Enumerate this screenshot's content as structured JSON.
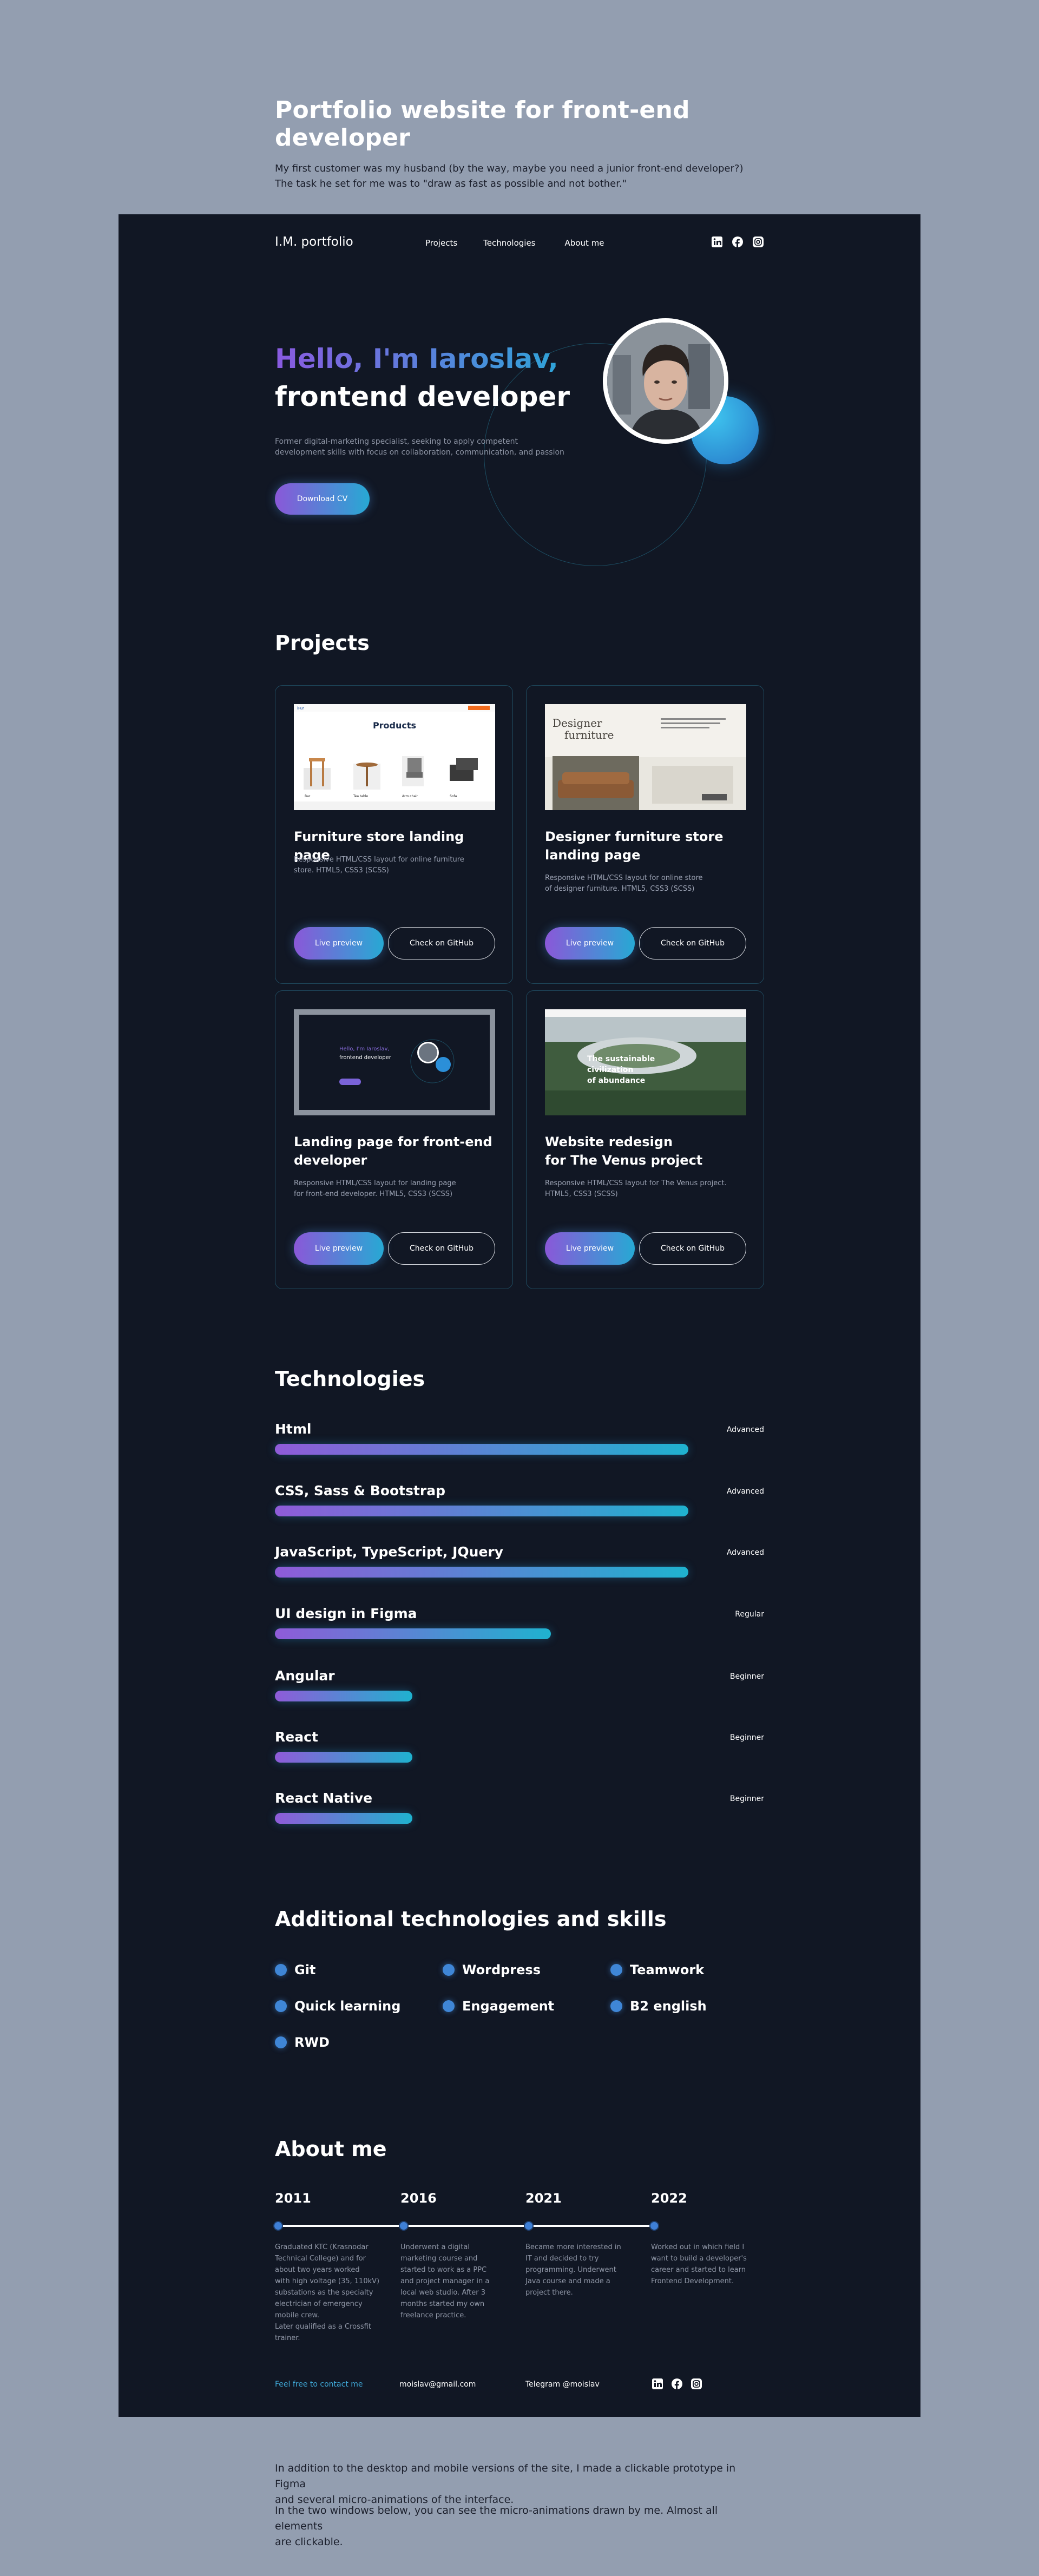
{
  "intro": {
    "title": "Portfolio website for front-end developer",
    "line1": "My first customer was my husband (by the way, maybe you need a junior front-end developer?)",
    "line2": "The task he set for me was to \"draw as fast as possible and not bother.\""
  },
  "header": {
    "logo": "I.M. portfolio",
    "nav": [
      "Projects",
      "Technologies",
      "About me"
    ],
    "social_icons": [
      "linkedin-icon",
      "facebook-icon",
      "instagram-icon"
    ]
  },
  "hero": {
    "greeting": "Hello, I'm Iaroslav,",
    "role": "frontend developer",
    "bio_line1": "Former digital-marketing specialist, seeking to apply competent",
    "bio_line2": "development skills with focus on collaboration, communication, and passion",
    "cv_button": "Download CV"
  },
  "projects": {
    "title": "Projects",
    "items": [
      {
        "title_line1": "Furniture store landing page",
        "title_line2": "",
        "desc_line1": "Responsive HTML/CSS layout for online furniture",
        "desc_line2": "store. HTML5, CSS3 (SCSS)",
        "live": "Live preview",
        "github": "Check on GitHub",
        "shot_heading": "Products"
      },
      {
        "title_line1": "Designer furniture store",
        "title_line2": "landing page",
        "desc_line1": "Responsive HTML/CSS layout for online store",
        "desc_line2": "of designer furniture. HTML5, CSS3 (SCSS)",
        "live": "Live preview",
        "github": "Check on GitHub",
        "shot_heading_1": "Designer",
        "shot_heading_2": "furniture"
      },
      {
        "title_line1": "Landing page for front-end",
        "title_line2": "developer",
        "desc_line1": "Responsive HTML/CSS layout for landing page",
        "desc_line2": "for front-end developer. HTML5, CSS3 (SCSS)",
        "live": "Live preview",
        "github": "Check on GitHub",
        "shot_heading_1": "Hello, I'm Iaroslav,",
        "shot_heading_2": "frontend developer"
      },
      {
        "title_line1": "Website redesign",
        "title_line2": "for The Venus project",
        "desc_line1": "Responsive HTML/CSS layout for The Venus project.",
        "desc_line2": "HTML5, CSS3 (SCSS)",
        "live": "Live preview",
        "github": "Check on GitHub",
        "shot_heading_1": "The sustainable",
        "shot_heading_2": "civilization",
        "shot_heading_3": "of abundance"
      }
    ]
  },
  "technologies": {
    "title": "Technologies",
    "items": [
      {
        "name": "Html",
        "level": "Advanced",
        "progress": 1.0
      },
      {
        "name": "CSS, Sass & Bootstrap",
        "level": "Advanced",
        "progress": 1.0
      },
      {
        "name": "JavaScript, TypeScript, JQuery",
        "level": "Advanced",
        "progress": 1.0
      },
      {
        "name": "UI design in Figma",
        "level": "Regular",
        "progress": 0.667
      },
      {
        "name": "Angular",
        "level": "Beginner",
        "progress": 0.333
      },
      {
        "name": "React",
        "level": "Beginner",
        "progress": 0.333
      },
      {
        "name": "React Native",
        "level": "Beginner",
        "progress": 0.333
      }
    ],
    "accent_start": "#8f5bd8",
    "accent_end": "#1fb2cf"
  },
  "skills": {
    "title": "Additional technologies and skills",
    "items": [
      "Git",
      "Wordpress",
      "Teamwork",
      "Quick learning",
      "Engagement",
      "B2 english",
      "RWD"
    ]
  },
  "about": {
    "title": "About me",
    "timeline": [
      {
        "year": "2011",
        "lines": [
          "Graduated KTC (Krasnodar",
          "Technical College) and for",
          "about two years worked",
          "with high voltage (35, 110kV)",
          "substations as the specialty",
          "electrician of emergency",
          "mobile crew.",
          "Later qualified as a Crossfit",
          "trainer."
        ]
      },
      {
        "year": "2016",
        "lines": [
          "Underwent a digital",
          "marketing course and",
          "started to work as a PPC",
          "and project manager in a",
          "local web studio. After 3",
          "months started my own",
          "freelance practice."
        ]
      },
      {
        "year": "2021",
        "lines": [
          "Became more interested in",
          "IT and decided to try",
          "programming. Underwent",
          "Java course and made a",
          "project there."
        ]
      },
      {
        "year": "2022",
        "lines": [
          "Worked out in which field I",
          "want to build a developer's",
          "career and started to learn",
          "Frontend Development."
        ]
      }
    ]
  },
  "footer": {
    "contact": "Feel free to contact me",
    "email": "moislav@gmail.com",
    "telegram": "Telegram @moislav",
    "contact_color": "#3fa9d8"
  },
  "outro": {
    "p1_line1": "In addition to the desktop and mobile versions of the site, I made a clickable prototype in Figma",
    "p1_line2": "and several micro-animations of the interface.",
    "p2_line1": "In the two windows below, you can see the micro-animations drawn by me. Almost all elements",
    "p2_line2": "are clickable."
  }
}
